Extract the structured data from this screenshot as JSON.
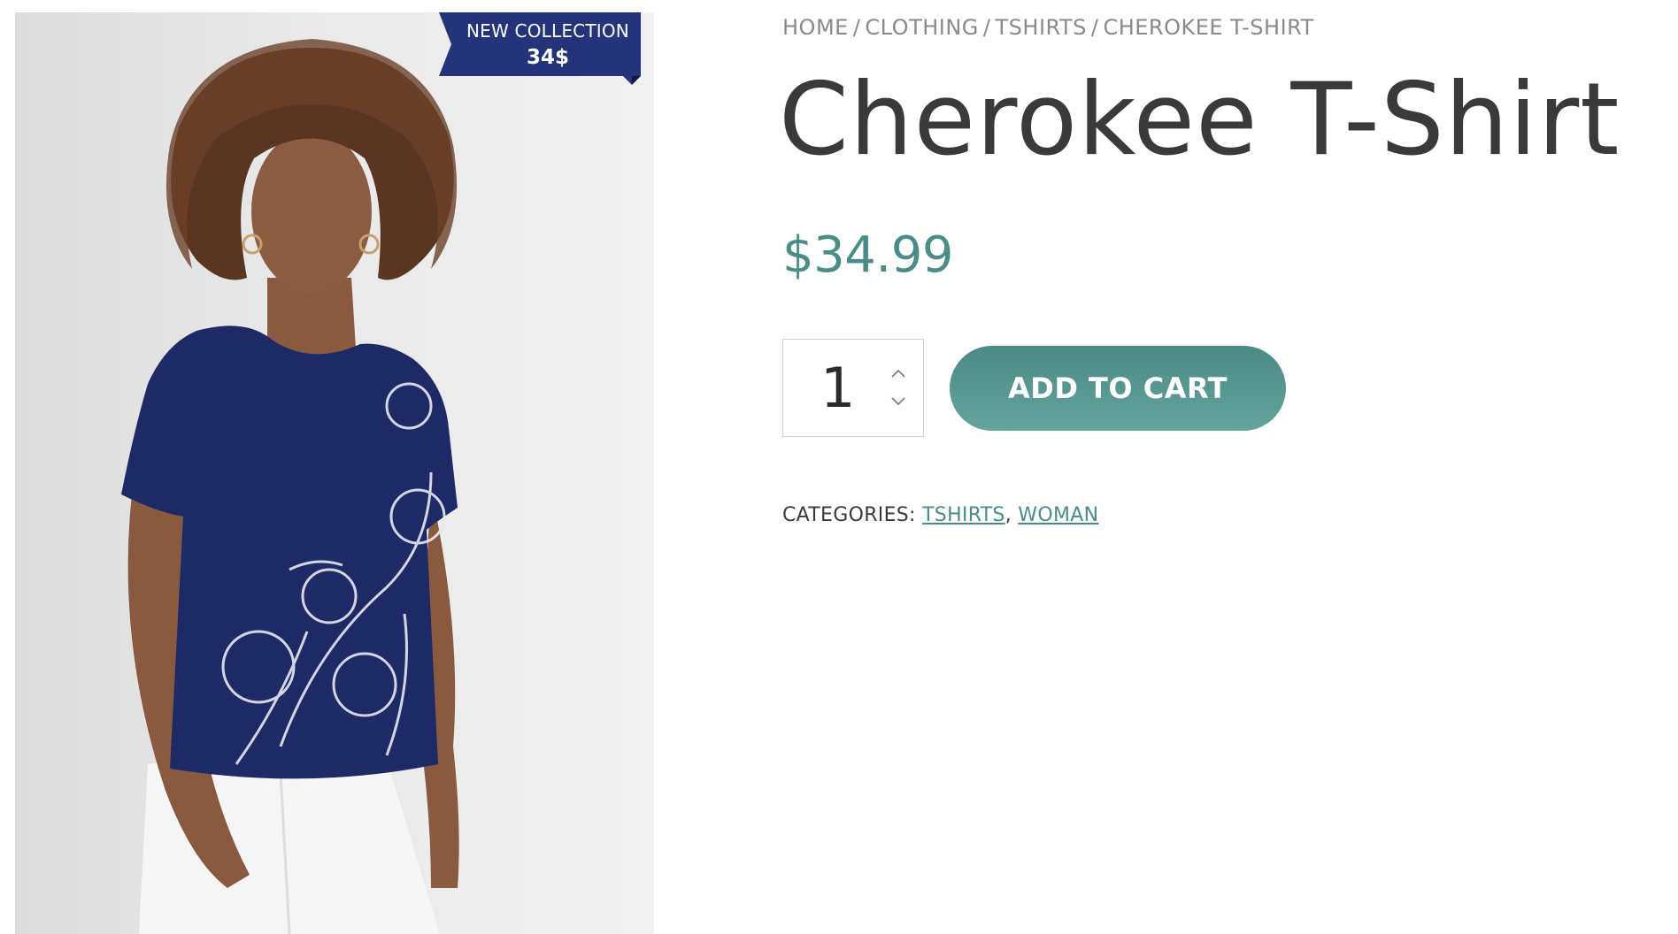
{
  "breadcrumb": {
    "items": [
      "HOME",
      "CLOTHING",
      "TSHIRTS"
    ],
    "separator": "/",
    "current": "CHEROKEE T-SHIRT"
  },
  "product": {
    "title": "Cherokee T-Shirt",
    "price": "$34.99",
    "badge": {
      "line1": "NEW COLLECTION",
      "line2": "34$"
    }
  },
  "cart": {
    "quantity": "1",
    "add_label": "ADD TO CART"
  },
  "categories": {
    "label": "CATEGORIES:",
    "items": [
      "TSHIRTS",
      "WOMAN"
    ],
    "separator": ","
  },
  "colors": {
    "accent": "#4a8c88",
    "ribbon": "#24337a",
    "shirt": "#1e2a66"
  }
}
